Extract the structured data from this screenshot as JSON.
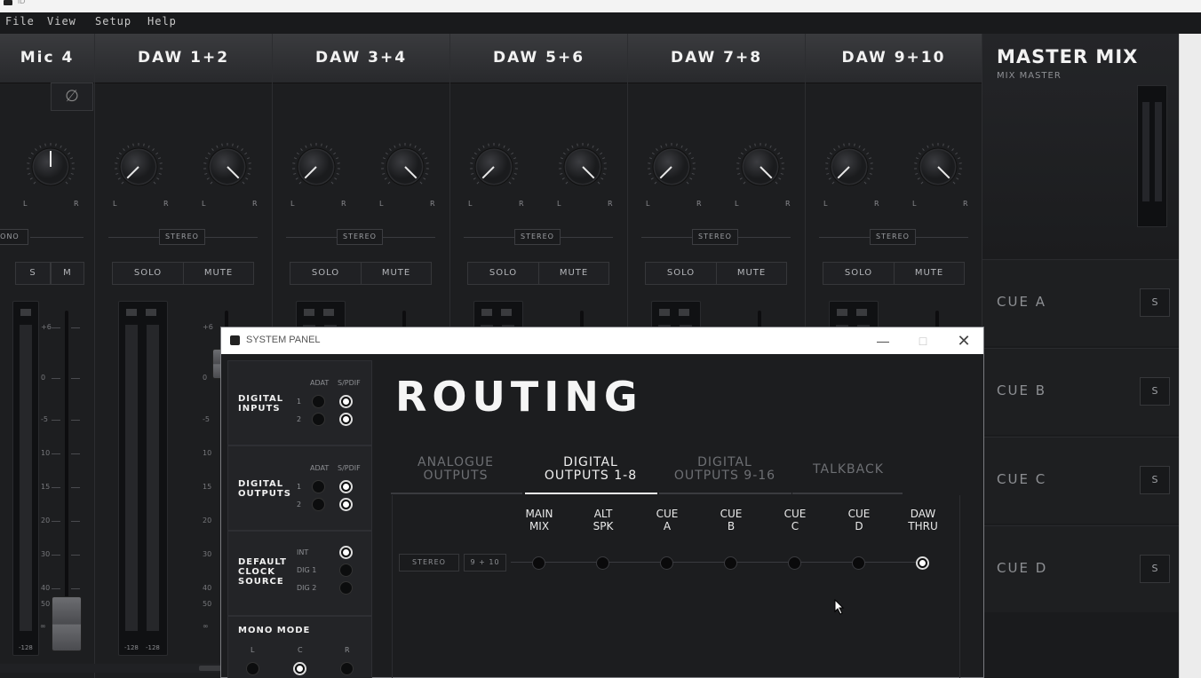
{
  "app": {
    "title": "iD"
  },
  "menu": [
    "File",
    "View",
    "Setup",
    "Help"
  ],
  "mixer": {
    "strips": [
      {
        "name": "Mic 4",
        "mode": "MONO",
        "solo": "S",
        "mute": "M",
        "phase_icon": "phase-invert-icon"
      },
      {
        "name": "DAW 1+2",
        "mode": "STEREO",
        "solo": "SOLO",
        "mute": "MUTE"
      },
      {
        "name": "DAW 3+4",
        "mode": "STEREO",
        "solo": "SOLO",
        "mute": "MUTE"
      },
      {
        "name": "DAW 5+6",
        "mode": "STEREO",
        "solo": "SOLO",
        "mute": "MUTE"
      },
      {
        "name": "DAW 7+8",
        "mode": "STEREO",
        "solo": "SOLO",
        "mute": "MUTE"
      },
      {
        "name": "DAW 9+10",
        "mode": "STEREO",
        "solo": "SOLO",
        "mute": "MUTE"
      }
    ],
    "pan_left": "L",
    "pan_right": "R",
    "scale": [
      "+6",
      "0",
      "-5",
      "10",
      "15",
      "20",
      "30",
      "40",
      "50",
      "∞"
    ],
    "meter_floor": "-128"
  },
  "master": {
    "title": "MASTER MIX",
    "subtitle": "MIX MASTER",
    "cues": [
      {
        "label": "CUE A",
        "solo": "S"
      },
      {
        "label": "CUE B",
        "solo": "S"
      },
      {
        "label": "CUE C",
        "solo": "S"
      },
      {
        "label": "CUE D",
        "solo": "S"
      }
    ]
  },
  "system_panel": {
    "title": "SYSTEM PANEL",
    "digital_inputs": {
      "title_line1": "DIGITAL",
      "title_line2": "INPUTS",
      "col_a": "ADAT",
      "col_b": "S/PDIF",
      "row1": "1",
      "row2": "2"
    },
    "digital_outputs": {
      "title_line1": "DIGITAL",
      "title_line2": "OUTPUTS",
      "col_a": "ADAT",
      "col_b": "S/PDIF",
      "row1": "1",
      "row2": "2"
    },
    "clock": {
      "title_line1": "DEFAULT",
      "title_line2": "CLOCK",
      "title_line3": "SOURCE",
      "opt1": "INT",
      "opt2": "DIG 1",
      "opt3": "DIG 2",
      "selected": "INT"
    },
    "mono_mode": {
      "title": "MONO MODE",
      "l": "L",
      "c": "C",
      "r": "R",
      "selected": "C"
    },
    "routing": {
      "title": "ROUTING",
      "tabs": [
        {
          "line1": "ANALOGUE",
          "line2": "OUTPUTS"
        },
        {
          "line1": "DIGITAL",
          "line2": "OUTPUTS 1-8"
        },
        {
          "line1": "DIGITAL",
          "line2": "OUTPUTS 9-16"
        },
        {
          "line1": "TALKBACK",
          "line2": ""
        }
      ],
      "active_tab": 1,
      "destinations": [
        {
          "line1": "MAIN",
          "line2": "MIX"
        },
        {
          "line1": "ALT",
          "line2": "SPK"
        },
        {
          "line1": "CUE",
          "line2": "A"
        },
        {
          "line1": "CUE",
          "line2": "B"
        },
        {
          "line1": "CUE",
          "line2": "C"
        },
        {
          "line1": "CUE",
          "line2": "D"
        },
        {
          "line1": "DAW",
          "line2": "THRU"
        }
      ],
      "source_mode": "STEREO",
      "source_channel": "9 + 10",
      "active_destination": 6
    }
  }
}
